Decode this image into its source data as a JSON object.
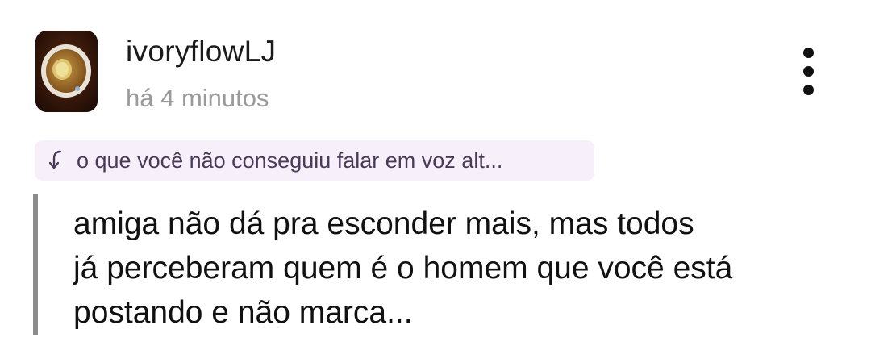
{
  "post": {
    "author": {
      "username": "ivoryflowLJ",
      "timestamp": "há 4 minutos",
      "avatar_icon": "tea-cup-avatar"
    },
    "menu_icon": "more-vertical-icon",
    "reply_to": {
      "icon": "reply-arrow-icon",
      "text": "o que você não conseguiu falar em voz alt..."
    },
    "body_lines": [
      "amiga não dá pra esconder mais, mas todos",
      "já perceberam quem é o homem que você está",
      "postando e não marca..."
    ]
  },
  "colors": {
    "username": "#1a1a1a",
    "timestamp": "#9a9a9a",
    "reply_chip_bg": "#f7f0fa",
    "reply_text": "#4a3a5a",
    "quote_bar": "#8c8c8c",
    "body_text": "#111111"
  }
}
